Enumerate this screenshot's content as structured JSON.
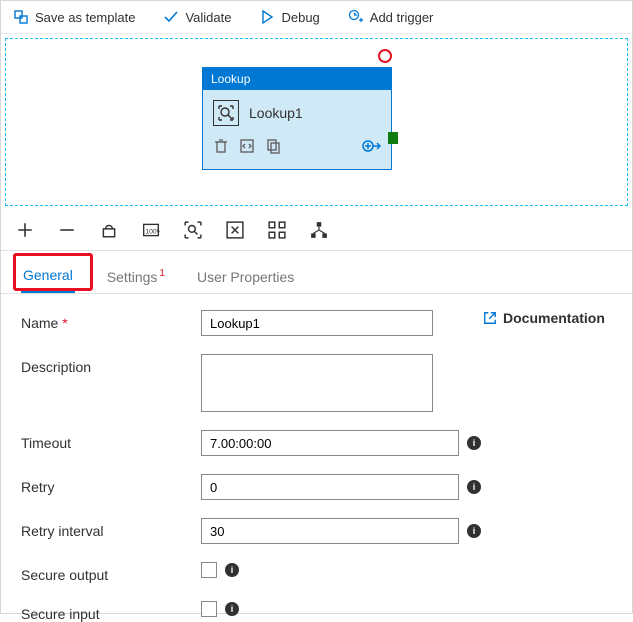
{
  "toolbar": {
    "save_template": "Save as template",
    "validate": "Validate",
    "debug": "Debug",
    "add_trigger": "Add trigger"
  },
  "activity": {
    "type_label": "Lookup",
    "name": "Lookup1"
  },
  "tabs": {
    "general": "General",
    "settings": "Settings",
    "settings_badge": "1",
    "user_properties": "User Properties"
  },
  "form": {
    "name_label": "Name",
    "name_value": "Lookup1",
    "description_label": "Description",
    "description_value": "",
    "timeout_label": "Timeout",
    "timeout_value": "7.00:00:00",
    "retry_label": "Retry",
    "retry_value": "0",
    "retry_interval_label": "Retry interval",
    "retry_interval_value": "30",
    "secure_output_label": "Secure output",
    "secure_input_label": "Secure input"
  },
  "links": {
    "documentation": "Documentation"
  }
}
